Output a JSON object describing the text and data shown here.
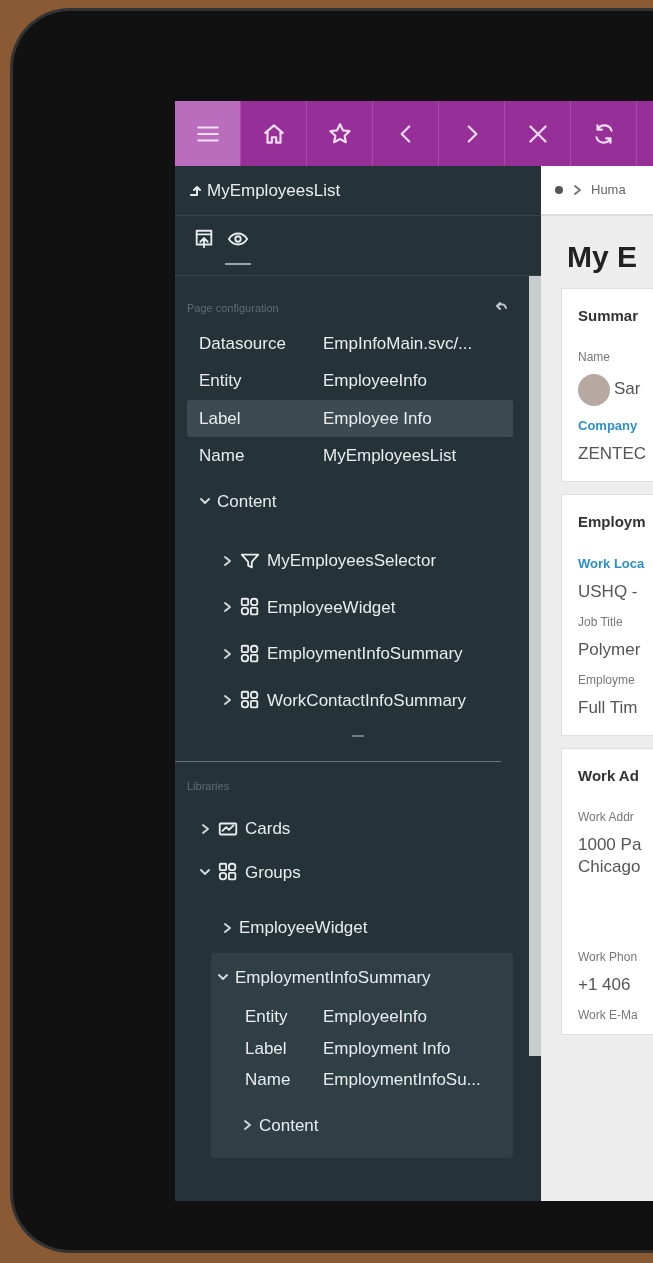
{
  "toolbar": {
    "buttons": [
      {
        "kind": "menu",
        "selected": true
      },
      {
        "kind": "home",
        "selected": false
      },
      {
        "kind": "star",
        "selected": false
      },
      {
        "kind": "back",
        "selected": false
      },
      {
        "kind": "forward",
        "selected": false
      },
      {
        "kind": "close",
        "selected": false
      },
      {
        "kind": "refresh",
        "selected": false
      }
    ]
  },
  "sidebar": {
    "title": "MyEmployeesList",
    "view_tabs": [
      {
        "kind": "publish",
        "selected": false
      },
      {
        "kind": "preview",
        "selected": true
      }
    ],
    "page_configuration": {
      "title": "Page configuration",
      "properties": [
        {
          "label": "Datasource",
          "value": "EmpInfoMain.svc/...",
          "selected": false
        },
        {
          "label": "Entity",
          "value": "EmployeeInfo",
          "selected": false
        },
        {
          "label": "Label",
          "value": "Employee Info",
          "selected": true
        },
        {
          "label": "Name",
          "value": "MyEmployeesList",
          "selected": false
        }
      ],
      "content": {
        "label": "Content",
        "expanded": true,
        "children": [
          {
            "label": "MyEmployeesSelector",
            "kind": "selector",
            "expanded": false
          },
          {
            "label": "EmployeeWidget",
            "kind": "group",
            "expanded": false
          },
          {
            "label": "EmploymentInfoSummary",
            "kind": "group",
            "expanded": false
          },
          {
            "label": "WorkContactInfoSummary",
            "kind": "group",
            "expanded": false
          }
        ]
      }
    },
    "libraries": {
      "title": "Libraries",
      "items": [
        {
          "label": "Cards",
          "kind": "cards",
          "expanded": false
        },
        {
          "label": "Groups",
          "kind": "group",
          "expanded": true,
          "children": [
            {
              "label": "EmployeeWidget",
              "expanded": false,
              "selected": false
            },
            {
              "label": "EmploymentInfoSummary",
              "expanded": true,
              "selected": true,
              "properties": [
                {
                  "label": "Entity",
                  "value": "EmployeeInfo"
                },
                {
                  "label": "Label",
                  "value": "Employment Info"
                },
                {
                  "label": "Name",
                  "value": "EmploymentInfoSu..."
                }
              ],
              "content": {
                "label": "Content",
                "expanded": false
              }
            }
          ]
        }
      ]
    }
  },
  "main": {
    "breadcrumb": "Huma",
    "title": "My E",
    "cards": [
      {
        "title": "Summar",
        "fields": [
          {
            "label": "Name",
            "value": "Sar",
            "kind": "person",
            "highlighted": false
          },
          {
            "label": "Company",
            "value": "ZENTEC",
            "kind": "text",
            "highlighted": true
          }
        ]
      },
      {
        "title": "Employm",
        "fields": [
          {
            "label": "Work Loca",
            "value": "USHQ -",
            "kind": "text",
            "highlighted": true
          },
          {
            "label": "Job Title",
            "value": "Polymer",
            "kind": "text",
            "highlighted": false
          },
          {
            "label": "Employme",
            "value": "Full Tim",
            "kind": "text",
            "highlighted": false
          }
        ]
      },
      {
        "title": "Work Ad",
        "fields": [
          {
            "label": "Work Addr",
            "value": "1000 Pa\nChicago",
            "kind": "address",
            "highlighted": false
          },
          {
            "label": "Work Phon",
            "value": "+1 406",
            "kind": "text",
            "highlighted": false
          },
          {
            "label": "Work E-Ma",
            "kind": "text",
            "highlighted": false
          }
        ]
      }
    ]
  }
}
